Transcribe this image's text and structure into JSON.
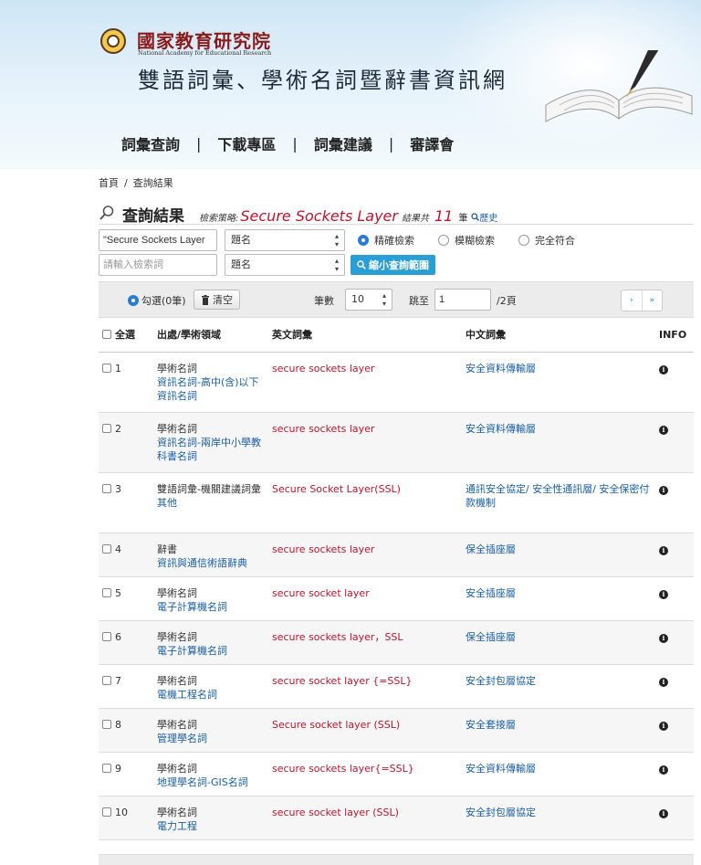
{
  "header": {
    "org_name": "國家教育研究院",
    "org_en": "National Academy for Educational Research",
    "site_title": "雙語詞彙、學術名詞暨辭書資訊網"
  },
  "nav": [
    "詞彙查詢",
    "下載專區",
    "詞彙建議",
    "審譯會"
  ],
  "nav_sep": "|",
  "breadcrumb": {
    "home": "首頁",
    "sep": "/",
    "current": "查詢結果"
  },
  "result": {
    "title": "查詢結果",
    "strategy_label": "檢索策略:",
    "term": "Secure Sockets Layer",
    "count_prefix": "結果共",
    "count": "11",
    "count_suffix": "筆",
    "history": "歷史"
  },
  "search": {
    "row1_value": "\"Secure Sockets Layer",
    "row1_field": "題名",
    "row2_placeholder": "請輸入檢索詞",
    "row2_field": "題名",
    "mode_exact": "精確檢索",
    "mode_fuzzy": "模糊檢索",
    "mode_full": "完全符合",
    "narrow_button": "縮小查詢範圍"
  },
  "toolbar": {
    "checked_label": "勾選(0筆)",
    "clear_label": "清空",
    "count_label": "筆數",
    "count_value": "10",
    "jump_label": "跳至",
    "jump_value": "1",
    "pages": "/2頁",
    "next": "›",
    "last": "»"
  },
  "table": {
    "headers": [
      "全選",
      "出處/學術領域",
      "英文詞彙",
      "中文詞彙",
      "INFO"
    ],
    "rows": [
      {
        "no": "1",
        "src1": "學術名詞",
        "src2": "資訊名詞-高中(含)以下資訊名詞",
        "en": "secure sockets layer",
        "zh": "安全資料傳輸層"
      },
      {
        "no": "2",
        "src1": "學術名詞",
        "src2": "資訊名詞-兩岸中小學教科書名詞",
        "en": "secure sockets layer",
        "zh": "安全資料傳輸層"
      },
      {
        "no": "3",
        "src1": "雙語詞彙-機關建議詞彙",
        "src2": "其他",
        "en": "Secure Socket Layer(SSL)",
        "zh": "通訊安全協定/ 安全性通訊層/ 安全保密付款機制"
      },
      {
        "no": "4",
        "src1": "辭書",
        "src2": "資訊與通信術語辭典",
        "en": "secure sockets layer",
        "zh": "保全插座層"
      },
      {
        "no": "5",
        "src1": "學術名詞",
        "src2": "電子計算機名詞",
        "en": "secure socket layer",
        "zh": "安全插座層"
      },
      {
        "no": "6",
        "src1": "學術名詞",
        "src2": "電子計算機名詞",
        "en": "secure sockets layer，SSL",
        "zh": "保全插座層"
      },
      {
        "no": "7",
        "src1": "學術名詞",
        "src2": "電機工程名詞",
        "en": "secure socket layer {=SSL}",
        "zh": "安全封包層協定"
      },
      {
        "no": "8",
        "src1": "學術名詞",
        "src2": "管理學名詞",
        "en": "Secure socket layer (SSL)",
        "zh": "安全套接層"
      },
      {
        "no": "9",
        "src1": "學術名詞",
        "src2": "地理學名詞-GIS名詞",
        "en": "secure sockets layer{=SSL}",
        "zh": "安全資料傳輸層"
      },
      {
        "no": "10",
        "src1": "學術名詞",
        "src2": "電力工程",
        "en": "secure socket layer (SSL)",
        "zh": "安全封包層協定"
      }
    ]
  },
  "colors": {
    "accent": "#c0142d",
    "link": "#1a5fa3",
    "button": "#2a9fd6"
  }
}
